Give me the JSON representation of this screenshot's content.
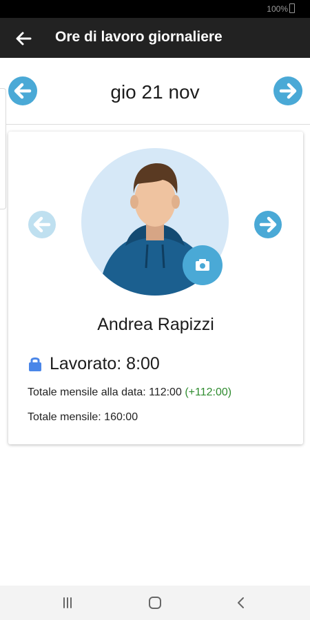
{
  "status_bar": {
    "battery": "100%"
  },
  "app_bar": {
    "title": "Ore di lavoro giornaliere",
    "back_icon": "arrow-left-icon"
  },
  "date_nav": {
    "date": "gio 21 nov",
    "prev_icon": "arrow-left-circle-icon",
    "next_icon": "arrow-right-circle-icon"
  },
  "worker": {
    "name": "Andrea Rapizzi",
    "worked_label": "Lavorato: 8:00",
    "monthly_to_date_label": "Totale mensile alla data: 112:00",
    "monthly_to_date_balance": "(+112:00)",
    "monthly_total_label": "Totale mensile: 160:00"
  },
  "colors": {
    "accent": "#4aa9d6",
    "accent_disabled": "#bfe0f0",
    "positive": "#2e8b2e",
    "lock": "#4a86e8"
  },
  "nav_bar": {
    "recents_icon": "recents-icon",
    "home_icon": "home-icon",
    "back_icon": "back-chevron-icon"
  }
}
